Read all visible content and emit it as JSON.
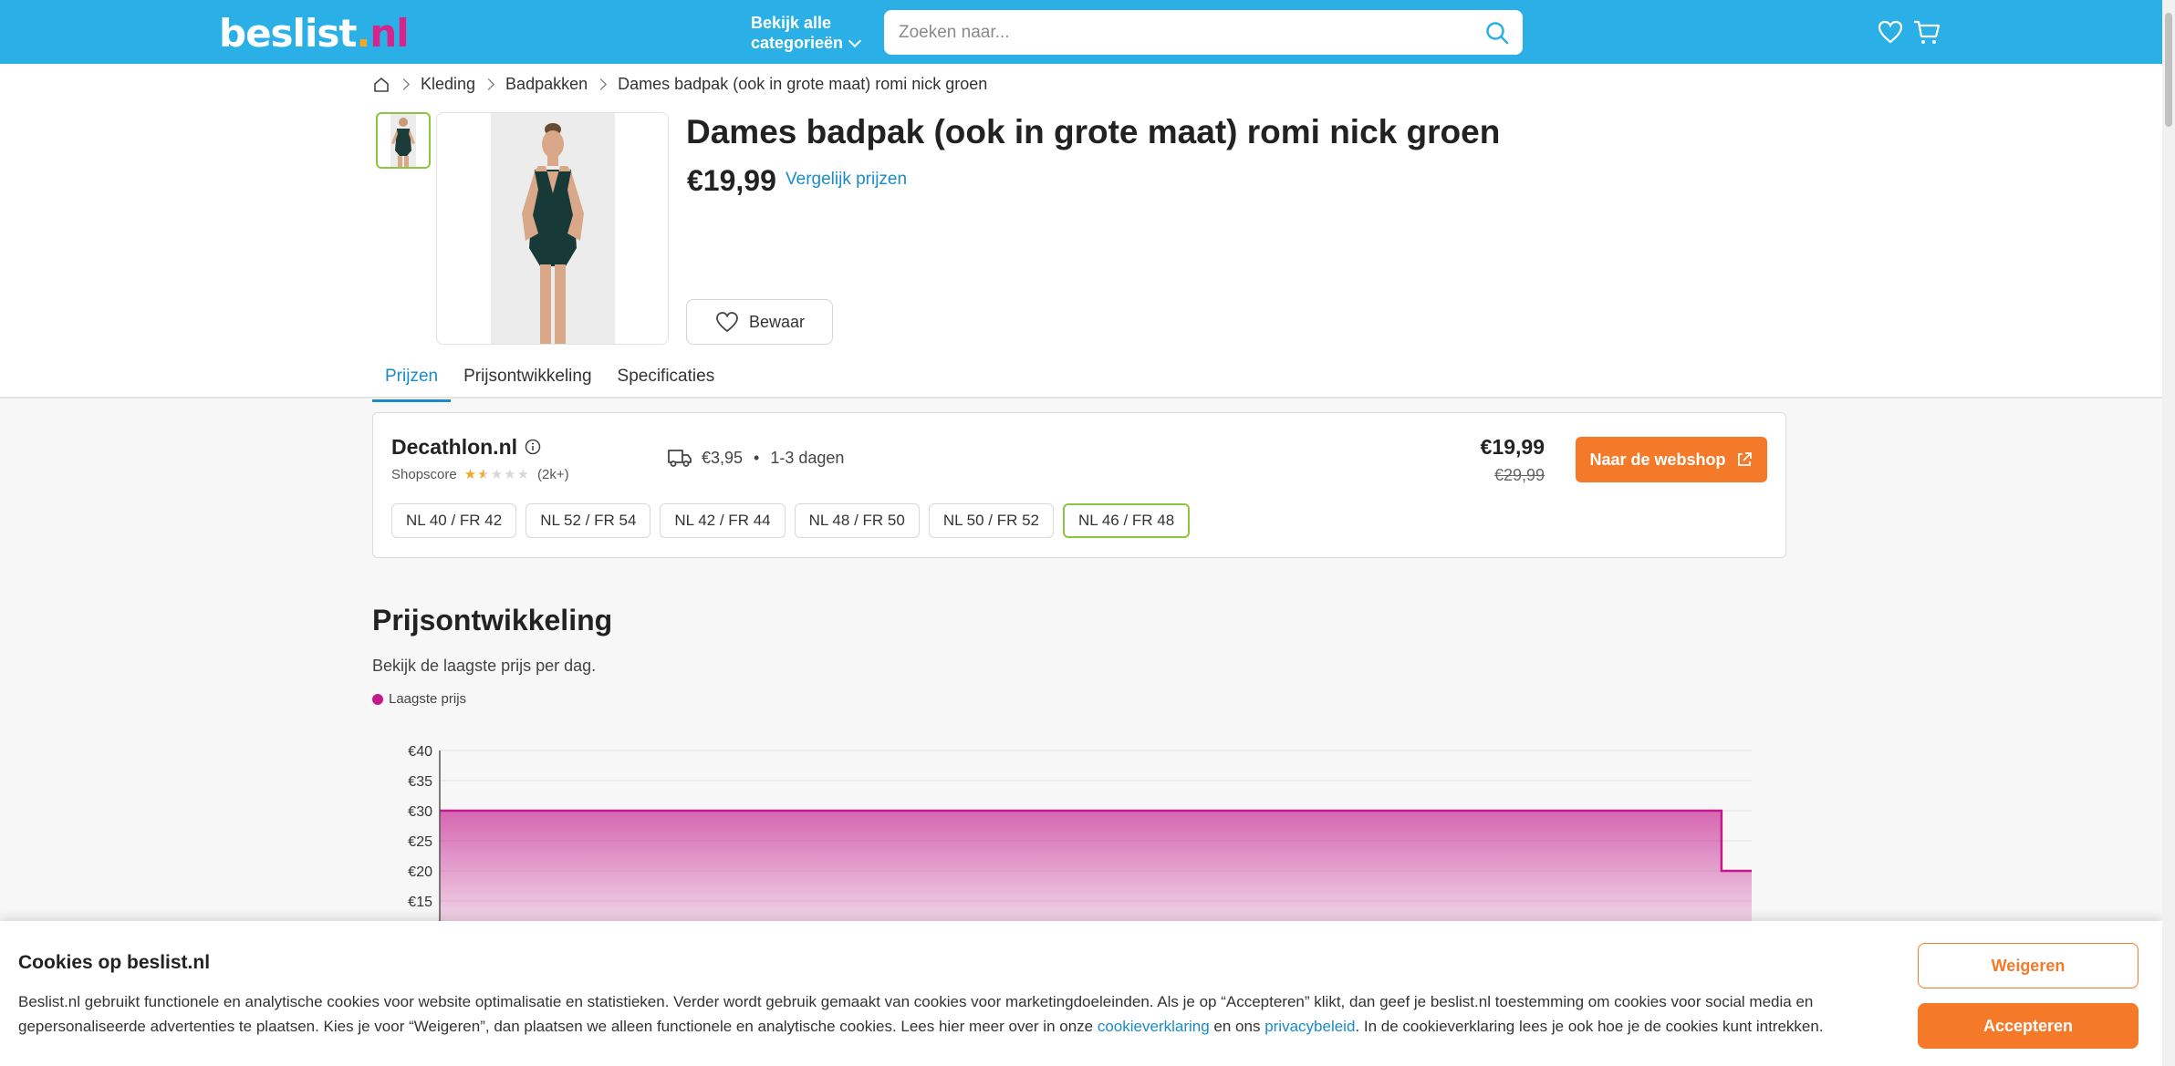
{
  "header": {
    "logo_main": "beslist",
    "logo_dot": ".",
    "logo_tld": "nl",
    "categories_line1": "Bekijk alle",
    "categories_line2": "categorieën",
    "search_placeholder": "Zoeken naar..."
  },
  "breadcrumb": [
    "Kleding",
    "Badpakken",
    "Dames badpak (ook in grote maat) romi nick groen"
  ],
  "product": {
    "title": "Dames badpak (ook in grote maat) romi nick groen",
    "price": "€19,99",
    "compare_label": "Vergelijk prijzen",
    "save_label": "Bewaar"
  },
  "tabs": [
    {
      "label": "Prijzen",
      "active": true
    },
    {
      "label": "Prijsontwikkeling",
      "active": false
    },
    {
      "label": "Specificaties",
      "active": false
    }
  ],
  "offer": {
    "shop": "Decathlon.nl",
    "shopscore_label": "Shopscore",
    "rating_stars": 1.5,
    "rating_max": 5,
    "rating_count": "(2k+)",
    "shipping": "€3,95",
    "delivery": "1-3 dagen",
    "price": "€19,99",
    "old_price": "€29,99",
    "button": "Naar de webshop",
    "sizes": [
      {
        "label": "NL 40 / FR 42",
        "selected": false
      },
      {
        "label": "NL 52 / FR 54",
        "selected": false
      },
      {
        "label": "NL 42 / FR 44",
        "selected": false
      },
      {
        "label": "NL 48 / FR 50",
        "selected": false
      },
      {
        "label": "NL 50 / FR 52",
        "selected": false
      },
      {
        "label": "NL 46 / FR 48",
        "selected": true
      }
    ]
  },
  "price_history": {
    "title": "Prijsontwikkeling",
    "subtitle": "Bekijk de laagste prijs per dag.",
    "legend": "Laagste prijs"
  },
  "chart_data": {
    "type": "area",
    "series": [
      {
        "name": "Laagste prijs",
        "x": [
          0,
          0.977,
          0.977,
          1
        ],
        "values": [
          30,
          30,
          20,
          20
        ]
      }
    ],
    "y_ticks": [
      "€40",
      "€35",
      "€30",
      "€25",
      "€20",
      "€15"
    ],
    "y_tick_values": [
      40,
      35,
      30,
      25,
      20,
      15
    ],
    "color": "#c4198c",
    "grid": true
  },
  "cookie": {
    "title": "Cookies op beslist.nl",
    "text_part1": "Beslist.nl gebruikt functionele en analytische cookies voor website optimalisatie en statistieken. Verder wordt gebruik gemaakt van cookies voor marketingdoeleinden. Als je op “Accepteren” klikt, dan geef je beslist.nl toestemming om cookies voor social media en gepersonaliseerde advertenties te plaatsen. Kies je voor “Weigeren”, dan plaatsen we alleen functionele en analytische cookies. Lees hier meer over in onze ",
    "link1": "cookieverklaring",
    "text_part2": " en ons ",
    "link2": "privacybeleid",
    "text_part3": ". In de cookieverklaring lees je ook hoe je de cookies kunt intrekken.",
    "reject": "Weigeren",
    "accept": "Accepteren"
  }
}
